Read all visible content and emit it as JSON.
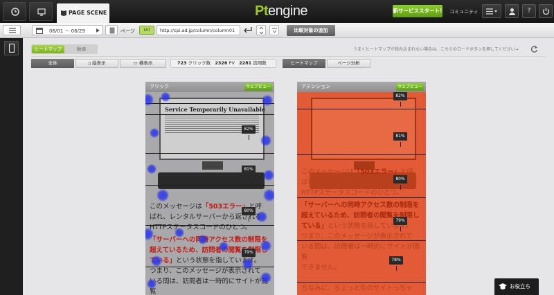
{
  "app": {
    "logo_pt": "Pt",
    "logo_engine": "engine"
  },
  "topbar": {
    "tab_label": "PAGE SCENE",
    "start_button": "新サービススタート!",
    "community": "コミュニティ",
    "help_label": "?"
  },
  "toolbar": {
    "date_range": "06/01 － 06/29",
    "page_label": "ページ",
    "url_tag": "Url",
    "url_value": "http://cpi.ad.jp/column/column01",
    "compare_label": "比較対象の追加"
  },
  "view_toggle": {
    "heatmap": "ヒートマップ",
    "data": "数値"
  },
  "notice": "うまくヒートマップが読み込まれない場合は、こちらのロードボタンを押してください→",
  "filters": {
    "all": "全体",
    "portrait": "縦表示",
    "landscape": "横表示",
    "mode_heatmap": "ヒートマップ",
    "mode_page": "ページ分析"
  },
  "stats": {
    "clicks_value": "723",
    "clicks_label": "クリック数",
    "pv_value": "2326",
    "pv_label": "PV",
    "visits_value": "2281",
    "visits_label": "訪問数"
  },
  "panels": {
    "click": {
      "title": "クリック",
      "webview": "ウェブビュー",
      "percentages": [
        "82%",
        "81%",
        "80%",
        "79%"
      ]
    },
    "attention": {
      "title": "アテンション",
      "webview": "ウェブビュー",
      "percentages": [
        "82%",
        "81%",
        "80%",
        "79%",
        "78%"
      ]
    }
  },
  "screen": {
    "title": "Service Temporarily Unavailable"
  },
  "article": {
    "line1_a": "このメッセージは",
    "line1_b": "「503エラー」",
    "line1_c": "と呼",
    "line2": "ばれ、レンタルサーバーから返される",
    "line3": "HTTPステータスコードのひとつ。",
    "line4": "「サーバーへの同時アクセス数の制限を",
    "line5": "超えているため、訪問者の閲覧を制限し",
    "line6_a": "ている」",
    "line6_b": "という状態を指しています。",
    "line7": "つまり、このメッセージが表示されて",
    "line8": "いる間は、訪問者は一時的にサイトが閲覧",
    "line9": "できません。",
    "line10": "ちなみに、ちょっとなのサイトっちゃ"
  },
  "help_button": "お役立ち",
  "colors": {
    "accent_green": "#7bb21e",
    "attention_red": "#e25a36",
    "click_blue": "#2838ff"
  }
}
